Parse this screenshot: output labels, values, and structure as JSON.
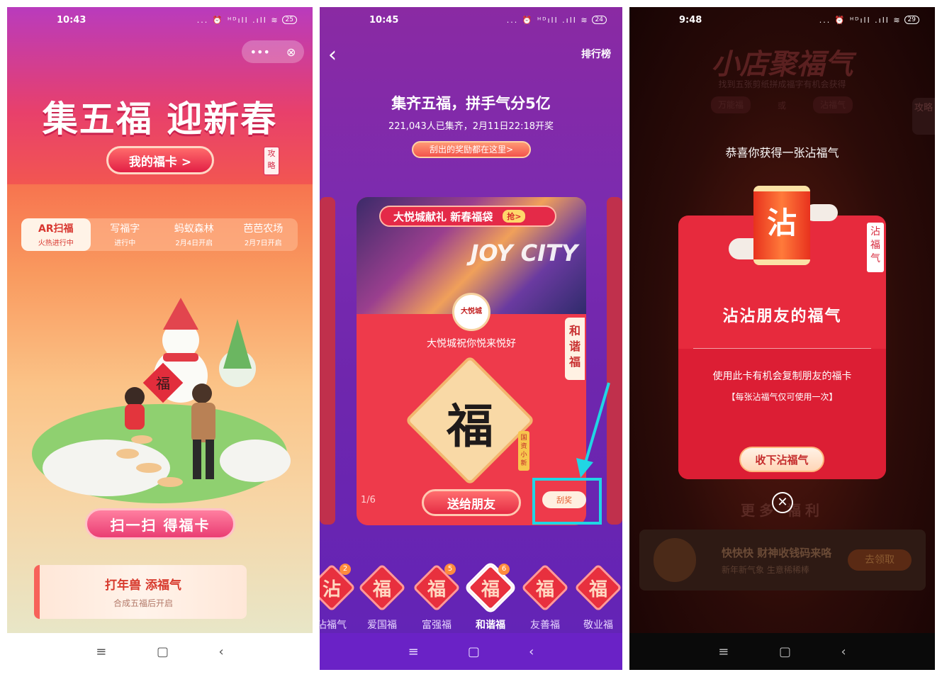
{
  "screen1": {
    "status": {
      "time": "10:43",
      "icons": "... ⏰ ᴴᴰıll .ıll ≋",
      "battery": "25"
    },
    "mini_more": "•••",
    "mini_close": "⊗",
    "title": "集五福 迎新春",
    "my_card_button": "我的福卡 >",
    "guide_label": "攻略",
    "tabs": [
      {
        "label": "AR扫福",
        "sub": "火热进行中"
      },
      {
        "label": "写福字",
        "sub": "进行中"
      },
      {
        "label": "蚂蚁森林",
        "sub": "2月4日开启"
      },
      {
        "label": "芭芭农场",
        "sub": "2月7日开启"
      }
    ],
    "scan_button": "扫一扫 得福卡",
    "beast_title": "打年兽 添福气",
    "beast_sub": "合成五福后开启",
    "scene_char": "福",
    "nav": [
      "≡",
      "▢",
      "‹"
    ]
  },
  "screen2": {
    "status": {
      "time": "10:45",
      "icons": "... ⏰ ᴴᴰıll .ıll ≋",
      "battery": "24"
    },
    "back": "‹",
    "ranking": "排行榜",
    "headline": "集齐五福，拼手气分5亿",
    "subline": "221,043人已集齐，2月11日22:18开奖",
    "reward_button": "刮出的奖励都在这里>",
    "card": {
      "banner": "大悦城献礼 新春福袋",
      "grab": "抢>",
      "photo_text": "JOY CITY",
      "logo_text": "大悦城",
      "wish": "大悦城祝你悦来悦好",
      "fu_char": "福",
      "vertical_label": "和谐福",
      "guo_label": "国资小新",
      "page": "1/6",
      "send_button": "送给朋友",
      "scratch_button": "刮奖"
    },
    "fu_list": [
      {
        "char": "沾",
        "name": "沾福气",
        "count": "2"
      },
      {
        "char": "福",
        "name": "爱国福",
        "count": ""
      },
      {
        "char": "福",
        "name": "富强福",
        "count": "5"
      },
      {
        "char": "福",
        "name": "和谐福",
        "count": "6"
      },
      {
        "char": "福",
        "name": "友善福",
        "count": ""
      },
      {
        "char": "福",
        "name": "敬业福",
        "count": ""
      }
    ],
    "nav": [
      "≡",
      "▢",
      "‹"
    ],
    "accent_highlight": "#20d6e4"
  },
  "screen3": {
    "status": {
      "time": "9:48",
      "icons": "... ⏰ ᴴᴰıll .ıll ≋",
      "battery": "29"
    },
    "dim_title": "小店聚福气",
    "dim_sub": "找到五张剪纸拼成福字有机会获得",
    "dim_chip_left": "万能福",
    "dim_or": "或",
    "dim_chip_right": "沾福气",
    "dim_guide": "攻略",
    "congrats": "恭喜你获得一张沾福气",
    "can_char": "沾",
    "side_label": "沾福气",
    "card_title": "沾沾朋友的福气",
    "desc": "使用此卡有机会复制朋友的福卡",
    "note": "【每张沾福气仅可使用一次】",
    "accept_button": "收下沾福气",
    "more_text": "更多 福利",
    "close": "✕",
    "promo_title": "快快快 财神收钱码来咯",
    "promo_sub": "新年新气象 生意稀稀棒",
    "promo_button": "去领取",
    "nav": [
      "≡",
      "▢",
      "‹"
    ]
  }
}
